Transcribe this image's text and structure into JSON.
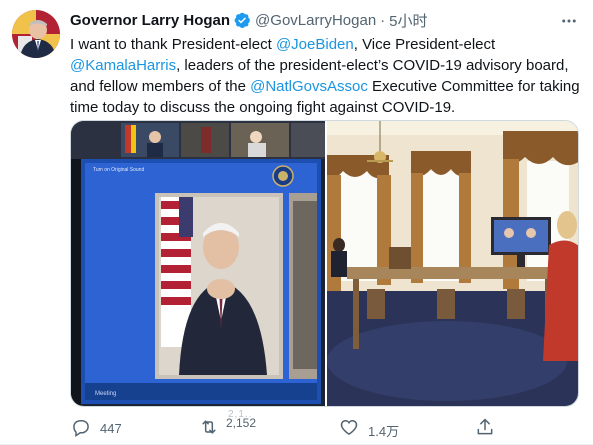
{
  "tweet": {
    "author_name": "Governor Larry Hogan",
    "author_handle": "@GovLarryHogan",
    "separator": "·",
    "timestamp": "5小时",
    "text_segments": [
      {
        "text": "I want to thank President-elect ",
        "type": "text"
      },
      {
        "text": "@JoeBiden",
        "type": "mention"
      },
      {
        "text": ", Vice President-elect ",
        "type": "text"
      },
      {
        "text": "@KamalaHarris",
        "type": "mention"
      },
      {
        "text": ", leaders of the president-elect’s COVID-19 advisory board, and fellow members of the ",
        "type": "text"
      },
      {
        "text": "@NatlGovsAssoc",
        "type": "mention"
      },
      {
        "text": " Executive Committee for taking time today to discuss the ongoing fight against COVID-19.",
        "type": "text"
      }
    ],
    "media": {
      "photo_left_caption": "Tum on Original Sound",
      "photo_left_menu": "Meeting"
    },
    "actions": {
      "reply_count": "447",
      "retweet_count": "2,152",
      "retweet_ghost": "2,1..",
      "like_count": "1.4万",
      "share_count": ""
    }
  },
  "colors": {
    "link": "#1b95e0",
    "verified": "#1d9bf0",
    "secondary_text": "#536471"
  },
  "icons": {
    "verified": "verified-badge-icon",
    "more": "more-dots-icon",
    "reply": "reply-bubble-icon",
    "retweet": "retweet-arrows-icon",
    "like": "heart-icon",
    "share": "share-upload-icon"
  }
}
